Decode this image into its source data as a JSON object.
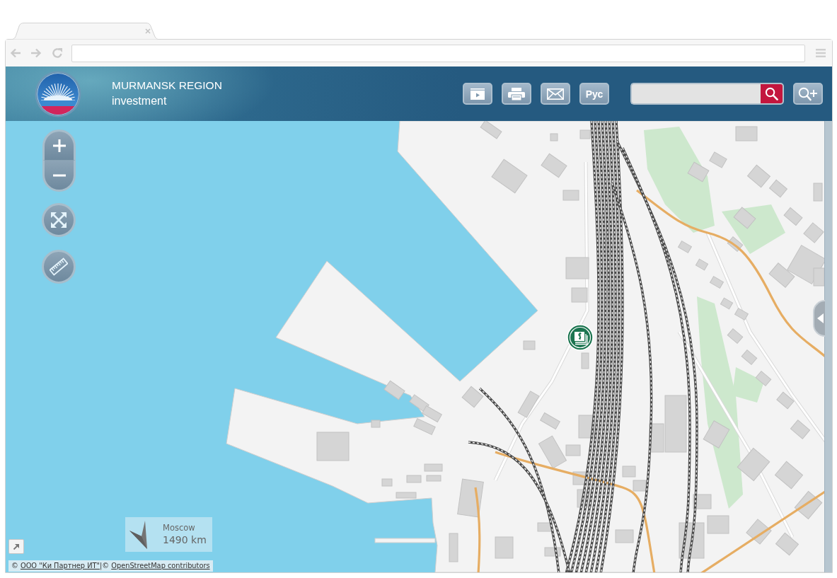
{
  "header": {
    "title": "MURMANSK REGION",
    "subtitle": "investment"
  },
  "toolbar": {
    "buttons": [
      {
        "kind": "slideshow"
      },
      {
        "kind": "print"
      },
      {
        "kind": "mail"
      },
      {
        "kind": "language",
        "label": "Рус"
      }
    ]
  },
  "direction": {
    "city": "Moscow",
    "distance": "1490 km"
  },
  "attribution": {
    "separator": "|",
    "items": [
      {
        "symbol": "©",
        "link": "ООО \"Ки Партнер ИТ\""
      },
      {
        "symbol": "©",
        "link": "OpenStreetMap contributors"
      }
    ]
  }
}
